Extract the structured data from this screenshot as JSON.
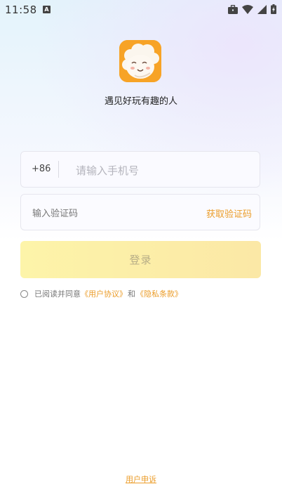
{
  "status_bar": {
    "time": "11:58",
    "notification_icon": "a-notification-icon",
    "icons": [
      "briefcase-icon",
      "wifi-icon",
      "signal-icon",
      "battery-charging-icon"
    ]
  },
  "app": {
    "logo_icon": "sheep-logo-icon",
    "brand_color": "#F7A326",
    "tagline": "遇见好玩有趣的人"
  },
  "login_form": {
    "country_code": "+86",
    "phone_placeholder": "请输入手机号",
    "phone_value": "",
    "code_placeholder": "输入验证码",
    "code_value": "",
    "get_code_label": "获取验证码",
    "submit_label": "登录"
  },
  "agreement": {
    "checked": false,
    "prefix": "已阅读并同意",
    "user_agreement": "《用户协议》",
    "and": "和",
    "privacy_policy": "《隐私条款》"
  },
  "footer": {
    "complaint_label": "用户申诉"
  },
  "colors": {
    "accent": "#EB9D2A",
    "button_gradient_start": "#FDF4A9",
    "button_gradient_end": "#FBE8A6"
  }
}
